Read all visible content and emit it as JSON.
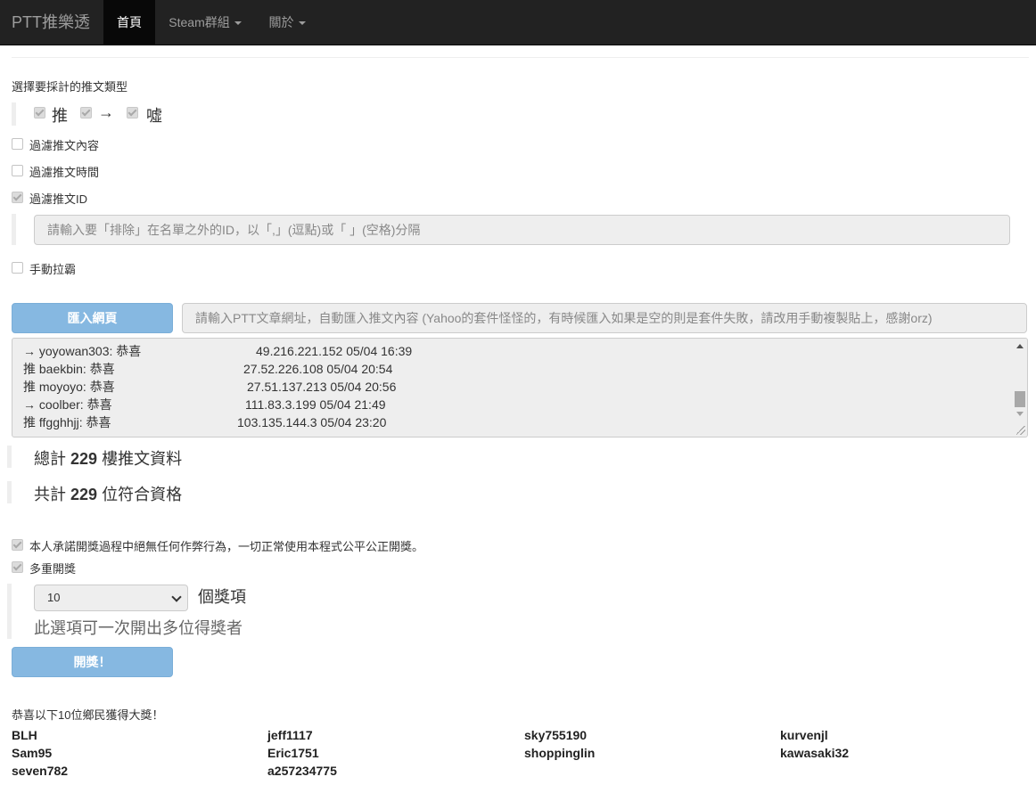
{
  "navbar": {
    "brand": "PTT推樂透",
    "items": [
      {
        "label": "首頁"
      },
      {
        "label": "Steam群組"
      },
      {
        "label": "關於"
      }
    ]
  },
  "push_types": {
    "heading": "選擇要採計的推文類型",
    "options": [
      {
        "label": "推",
        "checked": true
      },
      {
        "label": "→",
        "checked": true
      },
      {
        "label": "噓",
        "checked": true
      }
    ]
  },
  "filters": {
    "content": {
      "label": "過濾推文內容",
      "checked": false
    },
    "time": {
      "label": "過濾推文時間",
      "checked": false
    },
    "id": {
      "label": "過濾推文ID",
      "checked": true,
      "placeholder": "請輸入要「排除」在名單之外的ID，以「,」(逗點)或「 」(空格)分隔"
    },
    "manual": {
      "label": "手動拉霸",
      "checked": false
    }
  },
  "import": {
    "button": "匯入網頁",
    "placeholder": "請輸入PTT文章網址，自動匯入推文內容 (Yahoo的套件怪怪的，有時候匯入如果是空的則是套件失敗，請改用手動複製貼上，感謝orz)"
  },
  "pushes": [
    {
      "text": "→ yoyowan303: 恭喜",
      "meta": "49.216.221.152 05/04 16:39"
    },
    {
      "text": "推 baekbin: 恭喜",
      "meta": "27.52.226.108 05/04 20:54"
    },
    {
      "text": "推 moyoyo: 恭喜",
      "meta": "27.51.137.213 05/04 20:56"
    },
    {
      "text": "→ coolber: 恭喜",
      "meta": "111.83.3.199 05/04 21:49"
    },
    {
      "text": "推 ffgghhjj: 恭喜",
      "meta": "103.135.144.3 05/04 23:20"
    }
  ],
  "stats": {
    "total_prefix": "總計",
    "total_count": "229",
    "total_suffix": "樓推文資料",
    "qualified_prefix": "共計",
    "qualified_count": "229",
    "qualified_suffix": "位符合資格"
  },
  "lottery": {
    "promise": {
      "label": "本人承諾開獎過程中絕無任何作弊行為，一切正常使用本程式公平公正開獎。",
      "checked": true
    },
    "multi": {
      "label": "多重開獎",
      "checked": true
    },
    "prize_count": "10",
    "prize_unit": "個獎項",
    "hint": "此選項可一次開出多位得獎者",
    "button": "開獎！"
  },
  "results": {
    "heading": "恭喜以下10位鄉民獲得大獎！",
    "winners": [
      "BLH",
      "jeff1117",
      "sky755190",
      "kurvenjl",
      "Sam95",
      "Eric1751",
      "shoppinglin",
      "kawasaki32",
      "seven782",
      "a257234775"
    ]
  },
  "colors": {
    "navbar_bg": "#222222",
    "active_nav_bg": "#080808",
    "primary_button": "#86b8e1",
    "input_bg": "#eeeeee"
  }
}
